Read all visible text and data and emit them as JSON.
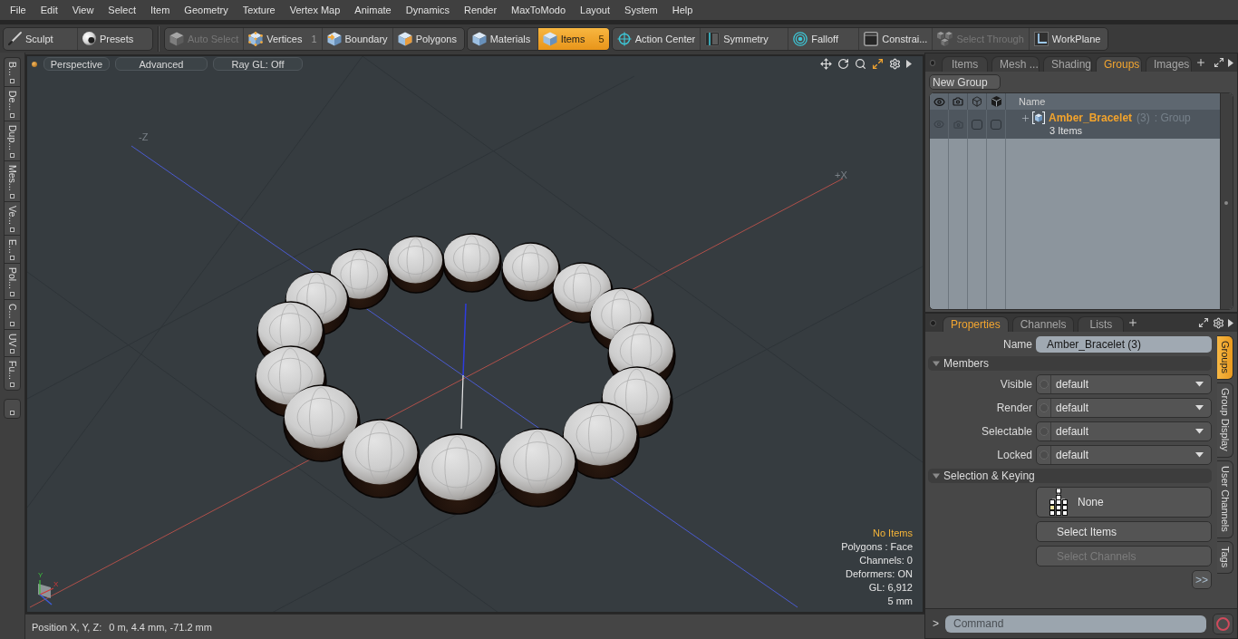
{
  "menu": [
    "File",
    "Edit",
    "View",
    "Select",
    "Item",
    "Geometry",
    "Texture",
    "Vertex Map",
    "Animate",
    "Dynamics",
    "Render",
    "MaxToModo",
    "Layout",
    "System",
    "Help"
  ],
  "toolbar": [
    {
      "buttons": [
        {
          "label": "Sculpt",
          "selected": false,
          "disabled": false
        },
        {
          "label": "Presets",
          "selected": false,
          "disabled": false
        }
      ]
    },
    {
      "buttons": [
        {
          "label": "Auto Select",
          "selected": false,
          "disabled": true
        },
        {
          "label": "Vertices",
          "badge": "1",
          "selected": false,
          "disabled": false
        },
        {
          "label": "Boundary",
          "selected": false,
          "disabled": false
        },
        {
          "label": "Polygons",
          "selected": false,
          "disabled": false
        }
      ]
    },
    {
      "buttons": [
        {
          "label": "Materials",
          "selected": false,
          "disabled": false
        },
        {
          "label": "Items",
          "badge": "5",
          "selected": true,
          "disabled": false
        }
      ]
    },
    {
      "buttons": [
        {
          "label": "Action Center",
          "selected": false,
          "disabled": false
        },
        {
          "label": "Symmetry",
          "selected": false,
          "disabled": false
        },
        {
          "label": "Falloff",
          "selected": false,
          "disabled": false
        },
        {
          "label": "Constrai...",
          "selected": false,
          "disabled": false
        },
        {
          "label": "Select Through",
          "selected": false,
          "disabled": true
        },
        {
          "label": "WorkPlane",
          "selected": false,
          "disabled": false
        }
      ]
    }
  ],
  "palette_tabs": [
    "B...",
    "De...",
    "Dup...",
    "Mes...",
    "Ve...",
    "E...",
    "Pol...",
    "C...",
    "UV",
    "Fu..."
  ],
  "viewport": {
    "buttons": [
      "Perspective",
      "Advanced",
      "Ray GL: Off"
    ],
    "axis_labels": [
      "-Z",
      "+X"
    ],
    "gizmo_labels": [
      "Y",
      "X"
    ],
    "info": [
      {
        "text": "No Items",
        "kind": "alert"
      },
      {
        "text": "Polygons : Face",
        "kind": "plain"
      },
      {
        "text": "Channels: 0",
        "kind": "plain"
      },
      {
        "text": "Deformers: ON",
        "kind": "plain"
      },
      {
        "text": "GL: 6,912",
        "kind": "plain"
      },
      {
        "text": "5 mm",
        "kind": "plain"
      }
    ]
  },
  "status_bar": {
    "label": "Position X, Y, Z:",
    "value": "0 m, 4.4 mm, -71.2 mm"
  },
  "groups_panel": {
    "tabs": [
      {
        "label": "Items",
        "selected": false
      },
      {
        "label": "Mesh ...",
        "selected": false
      },
      {
        "label": "Shading",
        "selected": false
      },
      {
        "label": "Groups",
        "selected": true
      },
      {
        "label": "Images",
        "selected": false
      }
    ],
    "new_button": "New Group",
    "name_column": "Name",
    "rows": [
      {
        "name": "Amber_Bracelet",
        "count": "(3)",
        "type": ": Group",
        "detail": "3 Items",
        "expanded": false,
        "flags": [
          {
            "checked": false
          },
          {
            "checked": false
          }
        ]
      }
    ]
  },
  "properties_panel": {
    "tabs": [
      {
        "label": "Properties",
        "selected": true
      },
      {
        "label": "Channels",
        "selected": false
      },
      {
        "label": "Lists",
        "selected": false
      }
    ],
    "name_field": {
      "label": "Name",
      "value": "Amber_Bracelet (3)"
    },
    "sections": [
      {
        "title": "Members",
        "kind": "dropdowns",
        "expanded": true,
        "rows": [
          {
            "label": "Visible",
            "value": "default"
          },
          {
            "label": "Render",
            "value": "default"
          },
          {
            "label": "Selectable",
            "value": "default"
          },
          {
            "label": "Locked",
            "value": "default"
          }
        ]
      },
      {
        "title": "Selection & Keying",
        "kind": "buttons",
        "expanded": true,
        "buttons": [
          {
            "label": "None",
            "kind": "preset",
            "disabled": false
          },
          {
            "label": "Select Items",
            "kind": "action",
            "disabled": false
          },
          {
            "label": "Select Channels",
            "kind": "action",
            "disabled": true
          }
        ]
      }
    ],
    "more_button": ">>",
    "side_tabs": [
      {
        "label": "Groups",
        "selected": true
      },
      {
        "label": "Group Display",
        "selected": false
      },
      {
        "label": "User Channels",
        "selected": false
      },
      {
        "label": "Tags",
        "selected": false
      }
    ]
  },
  "command_bar": {
    "prompt": ">",
    "placeholder": "Command"
  }
}
